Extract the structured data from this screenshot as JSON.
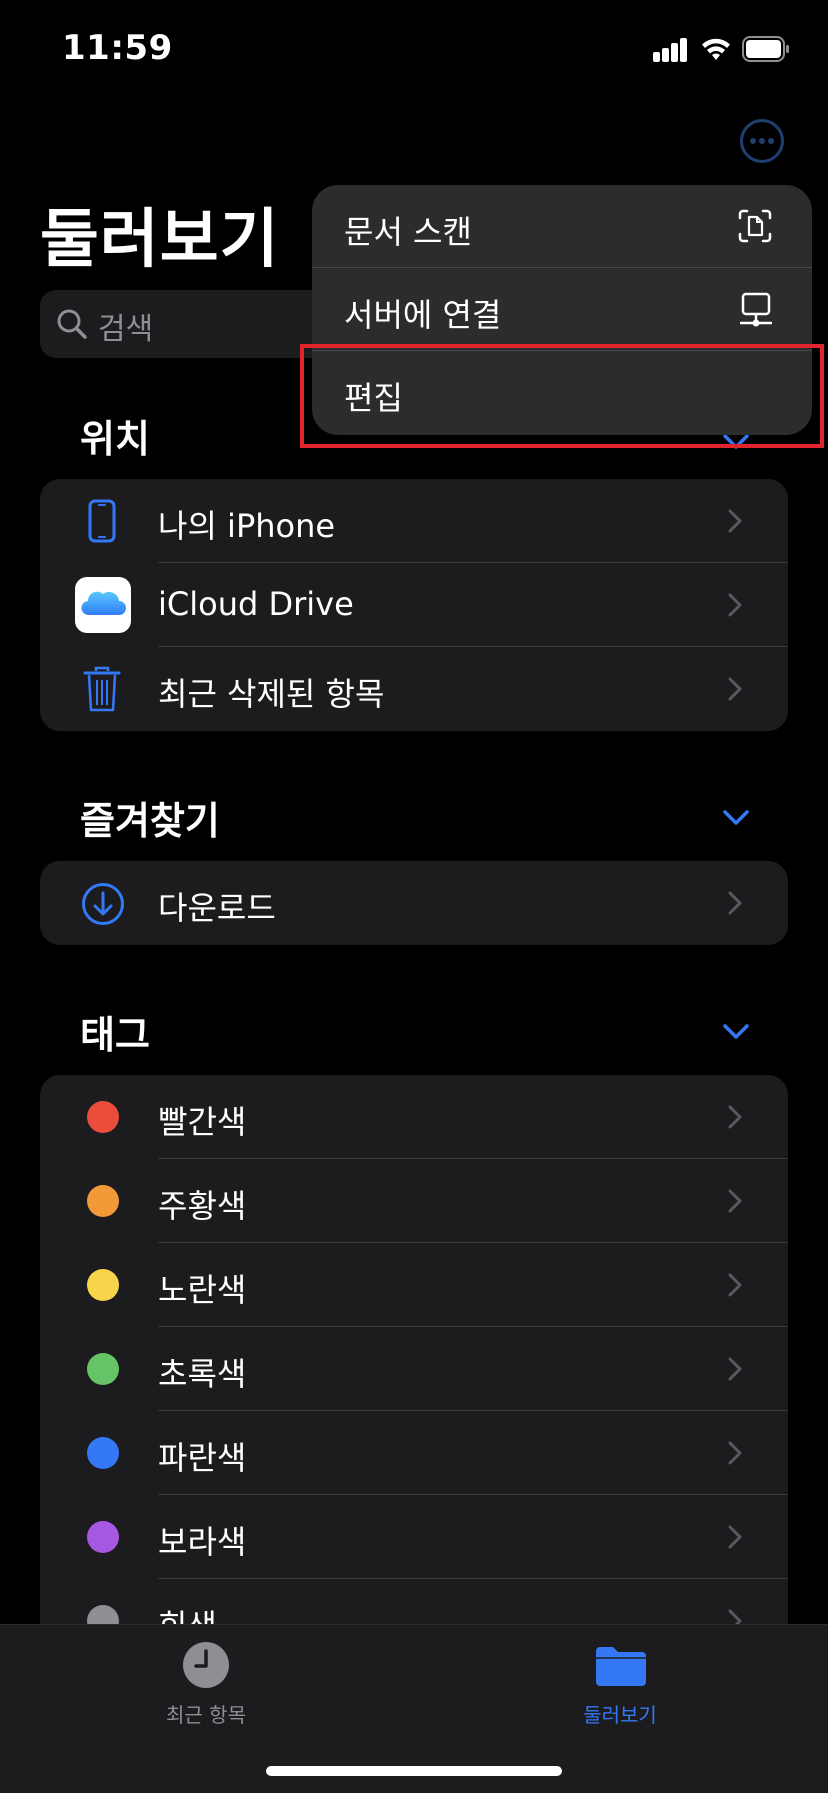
{
  "status_bar": {
    "time": "11:59"
  },
  "page": {
    "title": "둘러보기"
  },
  "search": {
    "placeholder": "검색"
  },
  "locations": {
    "title": "위치",
    "items": [
      {
        "label": "나의 iPhone"
      },
      {
        "label": "iCloud Drive"
      },
      {
        "label": "최근 삭제된 항목"
      }
    ]
  },
  "favorites": {
    "title": "즐겨찾기",
    "items": [
      {
        "label": "다운로드"
      }
    ]
  },
  "tags": {
    "title": "태그",
    "items": [
      {
        "label": "빨간색",
        "color": "#eb4d3d"
      },
      {
        "label": "주황색",
        "color": "#f19a37"
      },
      {
        "label": "노란색",
        "color": "#f7d449"
      },
      {
        "label": "초록색",
        "color": "#65c466"
      },
      {
        "label": "파란색",
        "color": "#3478f6"
      },
      {
        "label": "보라색",
        "color": "#a758e2"
      },
      {
        "label": "회색",
        "color": "#8e8e93"
      }
    ]
  },
  "menu": {
    "items": [
      {
        "label": "문서 스캔",
        "icon": "doc-scan-icon"
      },
      {
        "label": "서버에 연결",
        "icon": "server-icon"
      },
      {
        "label": "편집"
      }
    ]
  },
  "tab_bar": {
    "tabs": [
      {
        "label": "최근 항목",
        "icon": "clock-icon",
        "active": false
      },
      {
        "label": "둘러보기",
        "icon": "folder-icon",
        "active": true
      }
    ]
  },
  "colors": {
    "accent": "#3478f6",
    "highlight": "#e0242b"
  }
}
